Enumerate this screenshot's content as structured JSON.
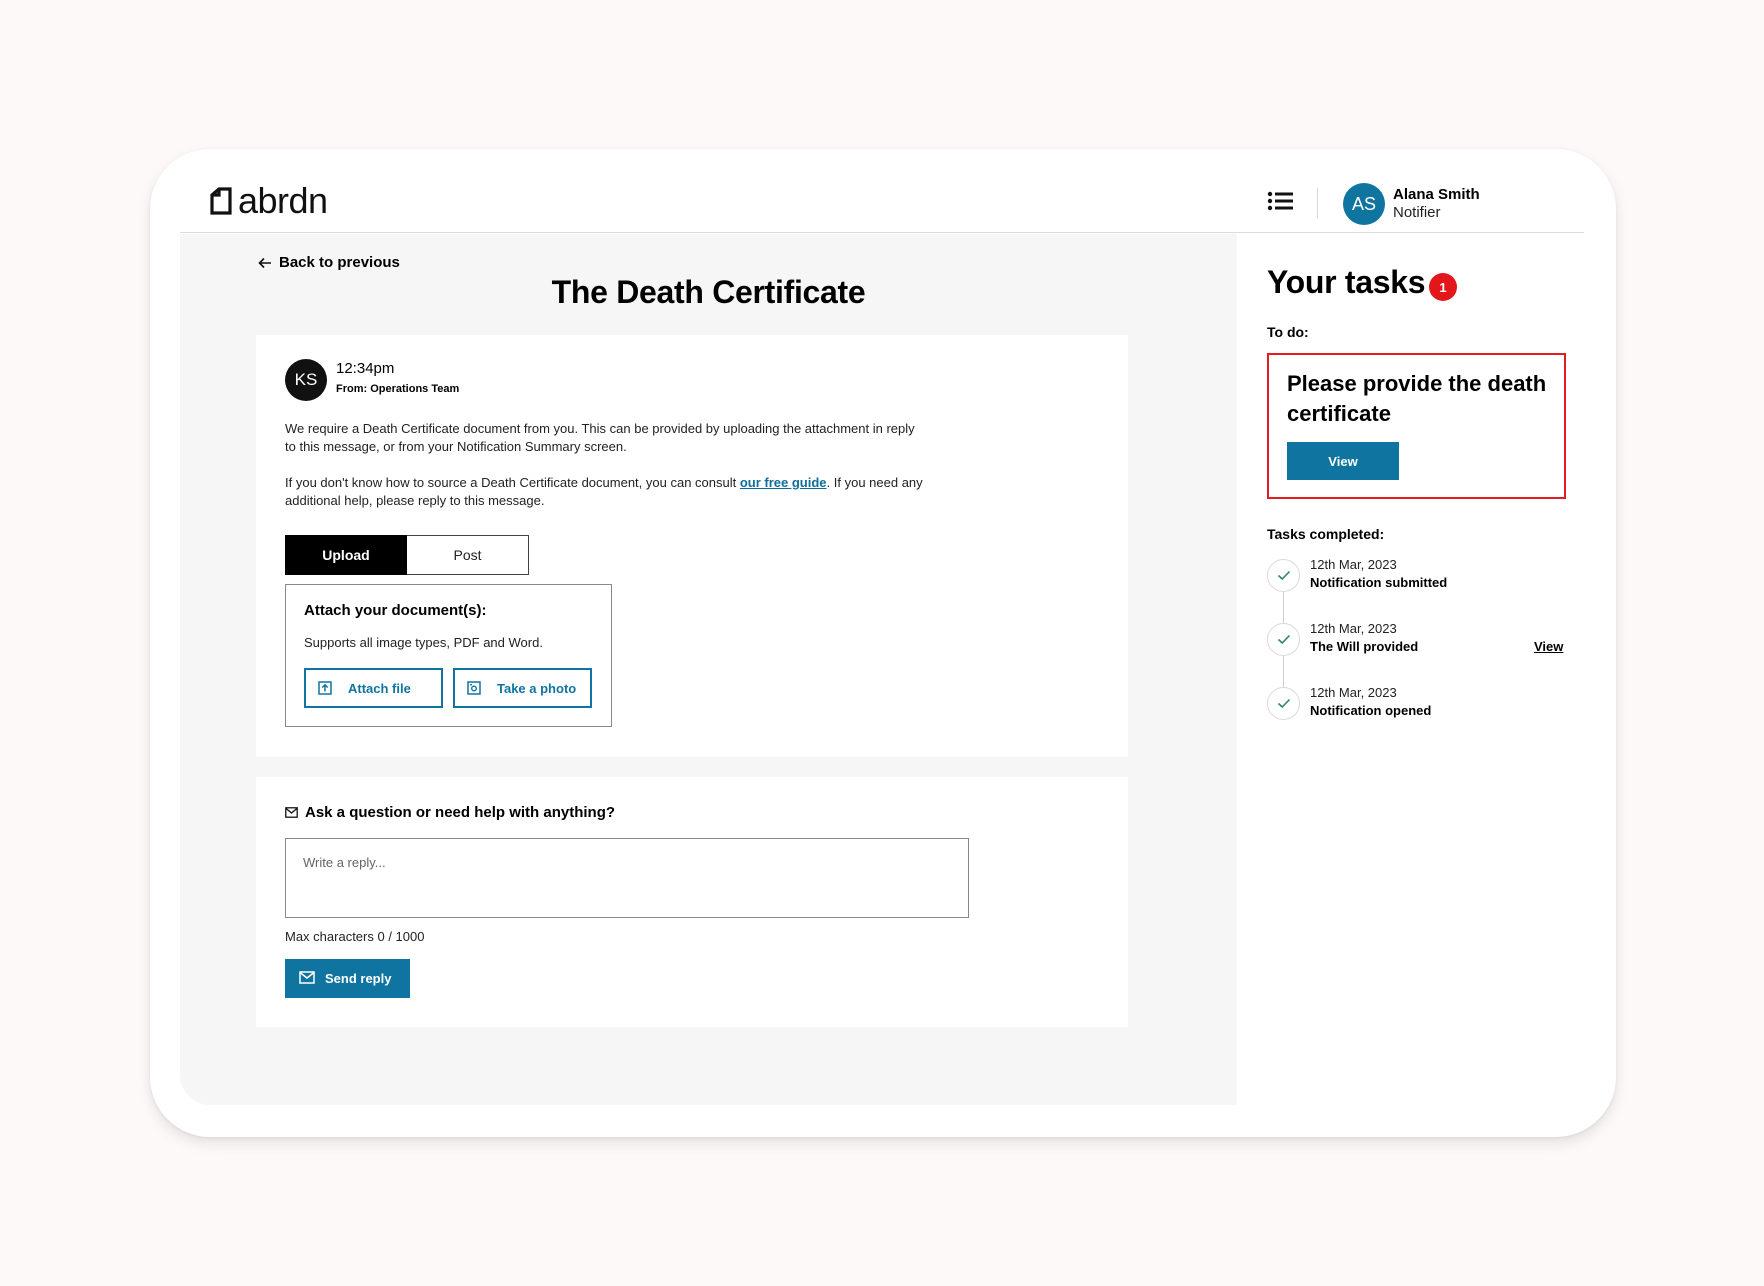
{
  "header": {
    "logo_text": "abrdn",
    "user": {
      "initials": "AS",
      "name": "Alana Smith",
      "role": "Notifier"
    }
  },
  "main": {
    "back_label": "Back to previous",
    "title": "The Death Certificate",
    "message": {
      "initials": "KS",
      "time": "12:34pm",
      "from": "From: Operations Team",
      "para1": "We require a Death Certificate document from you. This can be provided by uploading the attachment in reply to this message, or from your Notification Summary screen.",
      "para2_before": "If you don't know how to source a Death Certificate document, you can consult ",
      "para2_link": "our free guide",
      "para2_after": ". If you need any additional help, please reply to this message."
    },
    "tabs": [
      {
        "label": "Upload",
        "active": true
      },
      {
        "label": "Post",
        "active": false
      }
    ],
    "attach": {
      "title": "Attach your document(s):",
      "subtitle": "Supports all image types, PDF and Word.",
      "attach_btn": "Attach file",
      "photo_btn": "Take a photo"
    },
    "reply": {
      "question": "Ask a question or need help with anything?",
      "placeholder": "Write a reply...",
      "value": "",
      "max_chars": "Max characters 0 / 1000",
      "send_label": "Send reply"
    }
  },
  "tasks": {
    "title": "Your tasks",
    "badge_count": "1",
    "todo_label": "To do:",
    "todo_item": "Please provide the death certificate",
    "todo_view": "View",
    "completed_label": "Tasks completed:",
    "completed": [
      {
        "date": "12th Mar, 2023",
        "name": "Notification submitted",
        "view": ""
      },
      {
        "date": "12th Mar, 2023",
        "name": "The Will provided",
        "view": "View"
      },
      {
        "date": "12th Mar, 2023",
        "name": "Notification opened",
        "view": ""
      }
    ]
  },
  "colors": {
    "accent": "#0f75a0",
    "alert": "#e3171b",
    "check": "#2e8b57",
    "page_bg": "#fdf9f8",
    "panel_bg": "#f6f6f6"
  }
}
